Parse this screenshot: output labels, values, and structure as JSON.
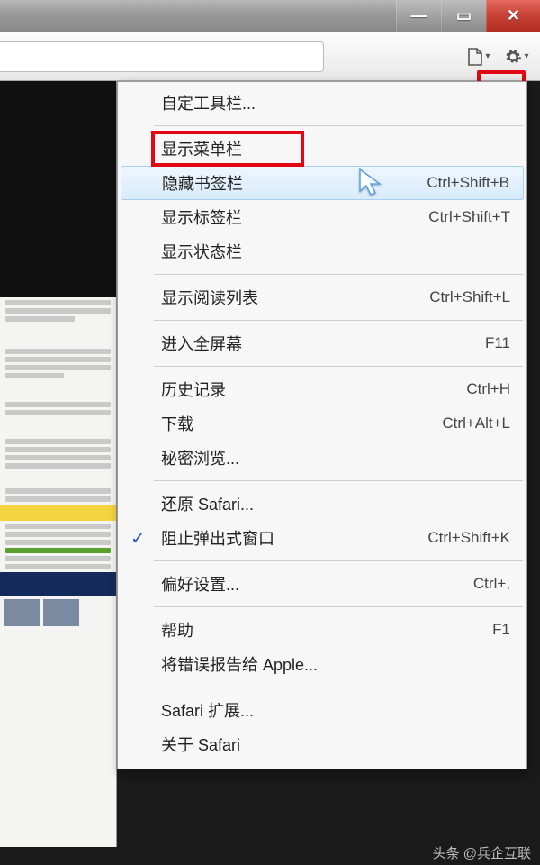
{
  "window": {
    "minimize": "—",
    "maximize": "▭",
    "close": "✕"
  },
  "menu": {
    "items": [
      {
        "label": "自定工具栏...",
        "shortcut": "",
        "checked": false,
        "highlighted": false,
        "hover": false
      },
      {
        "sep": true
      },
      {
        "label": "显示菜单栏",
        "shortcut": "",
        "checked": false,
        "highlighted": true,
        "hover": false
      },
      {
        "label": "隐藏书签栏",
        "shortcut": "Ctrl+Shift+B",
        "checked": false,
        "highlighted": false,
        "hover": true
      },
      {
        "label": "显示标签栏",
        "shortcut": "Ctrl+Shift+T",
        "checked": false,
        "highlighted": false,
        "hover": false
      },
      {
        "label": "显示状态栏",
        "shortcut": "",
        "checked": false,
        "highlighted": false,
        "hover": false
      },
      {
        "sep": true
      },
      {
        "label": "显示阅读列表",
        "shortcut": "Ctrl+Shift+L",
        "checked": false,
        "highlighted": false,
        "hover": false
      },
      {
        "sep": true
      },
      {
        "label": "进入全屏幕",
        "shortcut": "F11",
        "checked": false,
        "highlighted": false,
        "hover": false
      },
      {
        "sep": true
      },
      {
        "label": "历史记录",
        "shortcut": "Ctrl+H",
        "checked": false,
        "highlighted": false,
        "hover": false
      },
      {
        "label": "下载",
        "shortcut": "Ctrl+Alt+L",
        "checked": false,
        "highlighted": false,
        "hover": false
      },
      {
        "label": "秘密浏览...",
        "shortcut": "",
        "checked": false,
        "highlighted": false,
        "hover": false
      },
      {
        "sep": true
      },
      {
        "label": "还原 Safari...",
        "shortcut": "",
        "checked": false,
        "highlighted": false,
        "hover": false
      },
      {
        "label": "阻止弹出式窗口",
        "shortcut": "Ctrl+Shift+K",
        "checked": true,
        "highlighted": false,
        "hover": false
      },
      {
        "sep": true
      },
      {
        "label": "偏好设置...",
        "shortcut": "Ctrl+,",
        "checked": false,
        "highlighted": false,
        "hover": false
      },
      {
        "sep": true
      },
      {
        "label": "帮助",
        "shortcut": "F1",
        "checked": false,
        "highlighted": false,
        "hover": false
      },
      {
        "label": "将错误报告给 Apple...",
        "shortcut": "",
        "checked": false,
        "highlighted": false,
        "hover": false
      },
      {
        "sep": true
      },
      {
        "label": "Safari 扩展...",
        "shortcut": "",
        "checked": false,
        "highlighted": false,
        "hover": false
      },
      {
        "label": "关于 Safari",
        "shortcut": "",
        "checked": false,
        "highlighted": false,
        "hover": false
      }
    ]
  },
  "watermark": "头条 @兵企互联"
}
